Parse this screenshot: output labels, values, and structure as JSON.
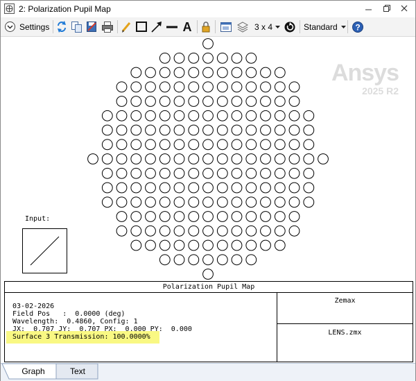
{
  "window": {
    "title": "2: Polarization Pupil Map",
    "controls": [
      "minimize-icon",
      "restore-icon",
      "close-icon"
    ]
  },
  "toolbar": {
    "settings_label": "Settings",
    "layout_label": "3 x 4",
    "style_label": "Standard",
    "icons": [
      "refresh-icon",
      "copy-icon",
      "save-icon",
      "print-icon",
      "pencil-icon",
      "rectangle-icon",
      "arrow-icon",
      "line-icon",
      "text-icon",
      "lock-icon",
      "window-icon",
      "layers-icon",
      "rotate-icon",
      "help-icon"
    ]
  },
  "watermark": {
    "brand": "Ansys",
    "version": "2025 R2"
  },
  "plot": {
    "input_label": "Input:",
    "polarization_state": "circular",
    "input_state": "linear 45°"
  },
  "footer": {
    "title": "Polarization Pupil Map",
    "date": "03-02-2026",
    "field_line": "Field Pos   :  0.0000 (deg)",
    "wavelength_line": "Wavelength:  0.4860, Config: 1",
    "jones_line": "JX:  0.707 JY:  0.707 PX:  0.000 PY:  0.000",
    "transmission_line": "Surface 3 Transmission: 100.0000%",
    "company": "Zemax",
    "file": "LENS.zmx"
  },
  "tabs": [
    {
      "label": "Graph",
      "active": true
    },
    {
      "label": "Text",
      "active": false
    }
  ],
  "colors": {
    "highlight": "#f7f55a",
    "active_tab": "#ffffff",
    "help_blue": "#2b5fb4"
  }
}
